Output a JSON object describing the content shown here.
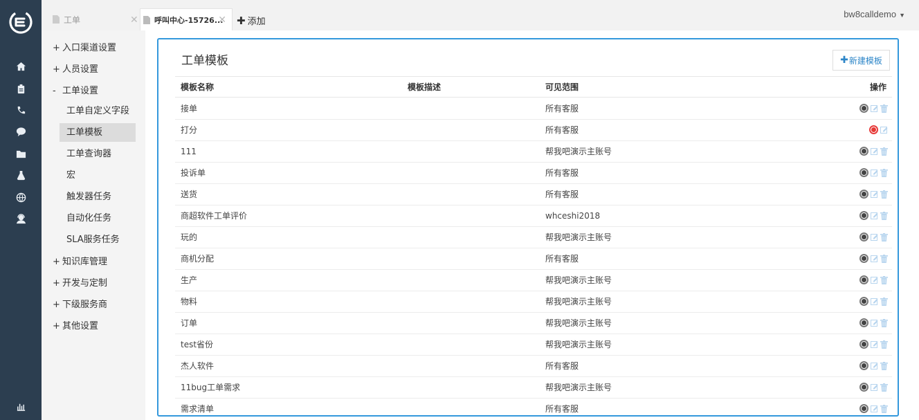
{
  "app": {
    "user": "bw8calldemo"
  },
  "tabs": [
    {
      "label": "工单"
    },
    {
      "label": "呼叫中心-15726..."
    }
  ],
  "add_tab_label": "添加",
  "rail_icons": [
    "home-icon",
    "clipboard-icon",
    "phone-icon",
    "chat-icon",
    "folder-icon",
    "flask-icon",
    "globe-icon",
    "support-icon",
    "bar-chart-icon"
  ],
  "sidebar": {
    "groups": [
      {
        "sign": "+",
        "label": "入口渠道设置"
      },
      {
        "sign": "+",
        "label": "人员设置"
      },
      {
        "sign": "-",
        "label": "工单设置"
      },
      {
        "sign": "+",
        "label": "知识库管理"
      },
      {
        "sign": "+",
        "label": "开发与定制"
      },
      {
        "sign": "+",
        "label": "下级服务商"
      },
      {
        "sign": "+",
        "label": "其他设置"
      }
    ],
    "children": [
      "工单自定义字段",
      "工单模板",
      "工单查询器",
      "宏",
      "触发器任务",
      "自动化任务",
      "SLA服务任务"
    ],
    "active_child": "工单模板"
  },
  "panel": {
    "title": "工单模板",
    "new_button": "新建模板",
    "columns": [
      "模板名称",
      "模板描述",
      "可见范围",
      "操作"
    ],
    "rows": [
      {
        "name": "接单",
        "desc": "",
        "scope": "所有客服",
        "enabled": false,
        "deletable": true
      },
      {
        "name": "打分",
        "desc": "",
        "scope": "所有客服",
        "enabled": true,
        "deletable": false
      },
      {
        "name": "111",
        "desc": "",
        "scope": "帮我吧演示主账号",
        "enabled": false,
        "deletable": true
      },
      {
        "name": "投诉单",
        "desc": "",
        "scope": "所有客服",
        "enabled": false,
        "deletable": true
      },
      {
        "name": "送货",
        "desc": "",
        "scope": "所有客服",
        "enabled": false,
        "deletable": true
      },
      {
        "name": "商超软件工单评价",
        "desc": "",
        "scope": "whceshi2018",
        "enabled": false,
        "deletable": true
      },
      {
        "name": "玩的",
        "desc": "",
        "scope": "帮我吧演示主账号",
        "enabled": false,
        "deletable": true
      },
      {
        "name": "商机分配",
        "desc": "",
        "scope": "所有客服",
        "enabled": false,
        "deletable": true
      },
      {
        "name": "生产",
        "desc": "",
        "scope": "帮我吧演示主账号",
        "enabled": false,
        "deletable": true
      },
      {
        "name": "物料",
        "desc": "",
        "scope": "帮我吧演示主账号",
        "enabled": false,
        "deletable": true
      },
      {
        "name": "订单",
        "desc": "",
        "scope": "帮我吧演示主账号",
        "enabled": false,
        "deletable": true
      },
      {
        "name": "test省份",
        "desc": "",
        "scope": "帮我吧演示主账号",
        "enabled": false,
        "deletable": true
      },
      {
        "name": "杰人软件",
        "desc": "",
        "scope": "所有客服",
        "enabled": false,
        "deletable": true
      },
      {
        "name": "11bug工单需求",
        "desc": "",
        "scope": "帮我吧演示主账号",
        "enabled": false,
        "deletable": true
      },
      {
        "name": "需求清单",
        "desc": "",
        "scope": "所有客服",
        "enabled": false,
        "deletable": true
      }
    ]
  },
  "colors": {
    "rail": "#2c3e50",
    "accent": "#3398dc",
    "active_toggle": "#e53935",
    "link": "#2d86c8"
  }
}
